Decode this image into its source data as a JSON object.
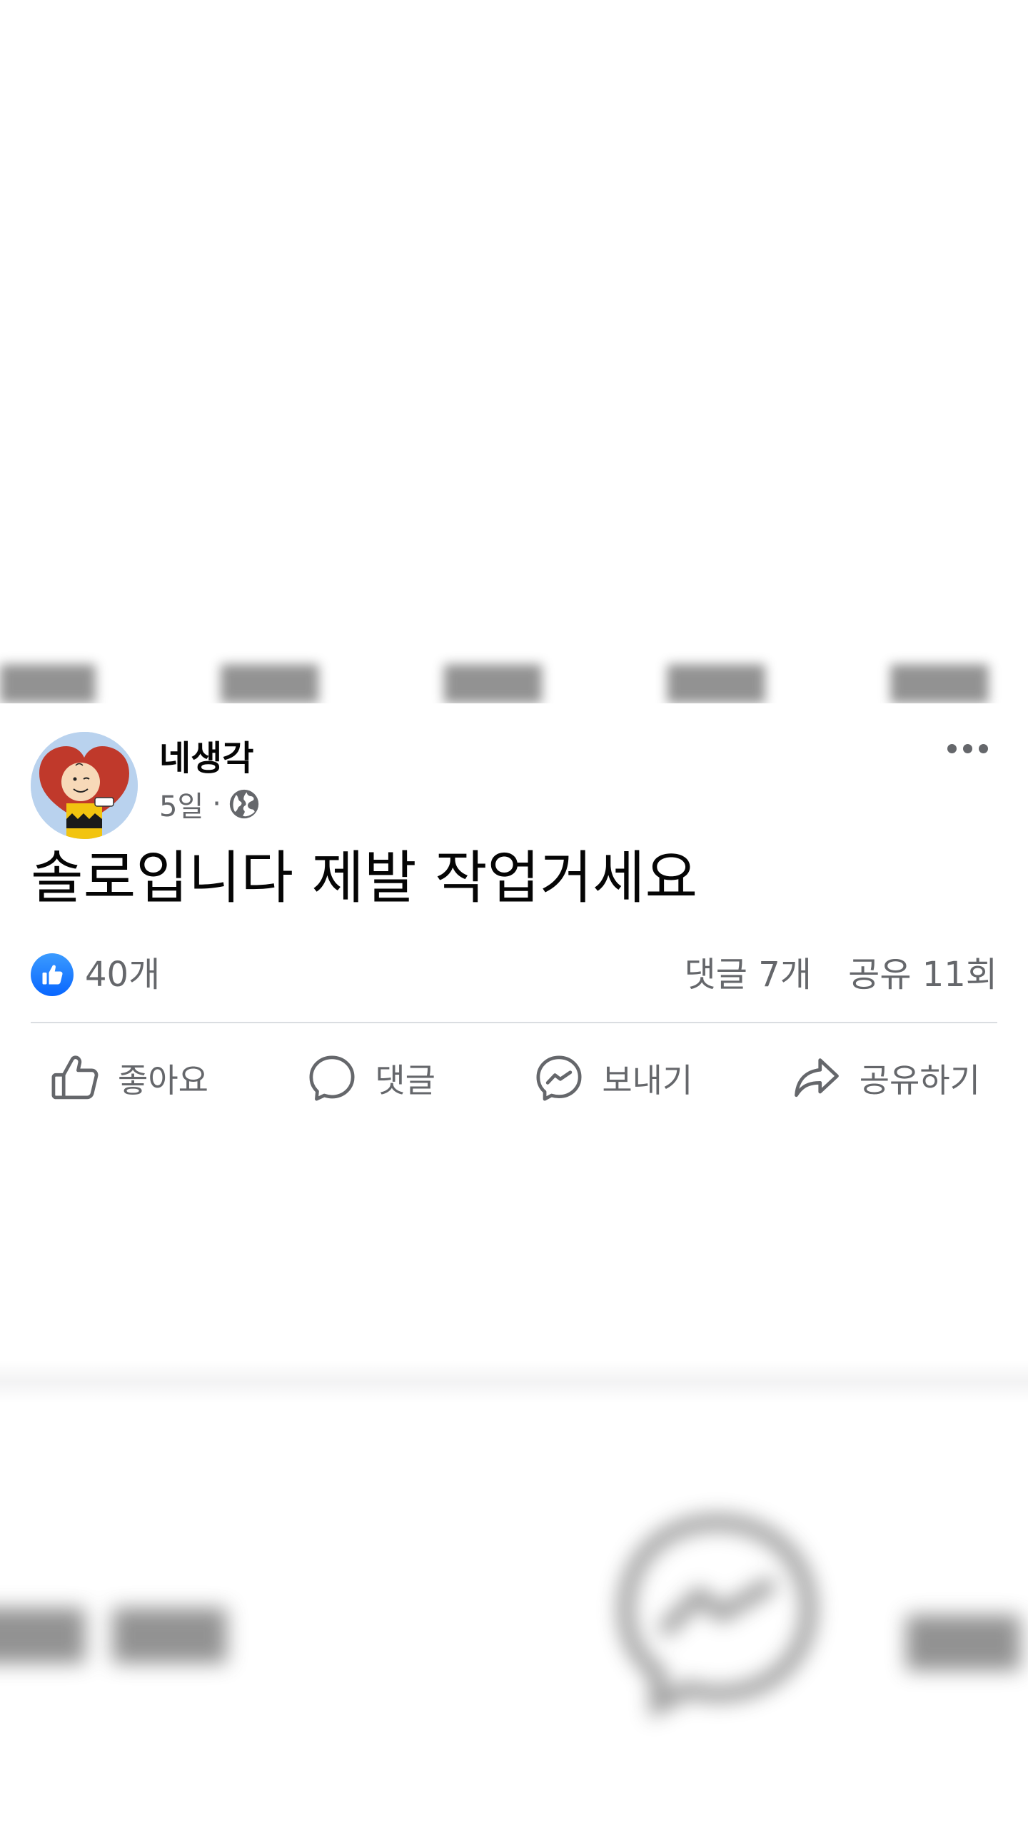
{
  "post": {
    "author": "네생각",
    "time": "5일",
    "separator": "·",
    "audience_icon": "globe-icon",
    "text": "솔로입니다 제발 작업거세요",
    "reactions": {
      "icon": "like-icon",
      "like_count": "40개"
    },
    "comment_count": "댓글 7개",
    "share_count": "공유 11회",
    "actions": {
      "like_label": "좋아요",
      "comment_label": "댓글",
      "send_label": "보내기",
      "share_label": "공유하기"
    }
  },
  "colors": {
    "text_primary": "#050505",
    "text_secondary": "#65676b",
    "like_blue": "#0866ff",
    "divider": "#dadde1"
  }
}
